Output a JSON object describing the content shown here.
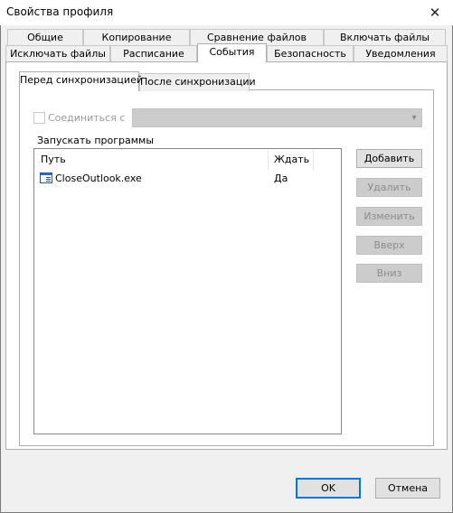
{
  "window": {
    "title": "Свойства профиля"
  },
  "tabs_row1": [
    "Общие",
    "Копирование",
    "Сравнение файлов",
    "Включать файлы"
  ],
  "tabs_row2": [
    "Исключать файлы",
    "Расписание",
    "События",
    "Безопасность",
    "Уведомления"
  ],
  "selected_tab": "События",
  "subtabs": [
    "Перед синхронизацией",
    "После синхронизации"
  ],
  "selected_subtab": "Перед синхронизацией",
  "connect": {
    "label": "Соединиться с",
    "checked": false,
    "value": ""
  },
  "programs": {
    "label": "Запускать программы",
    "columns": {
      "path": "Путь",
      "wait": "Ждать"
    },
    "rows": [
      {
        "path": "CloseOutlook.exe",
        "wait": "Да"
      }
    ]
  },
  "actions": {
    "add": "Добавить",
    "remove": "Удалить",
    "edit": "Изменить",
    "up": "Вверх",
    "down": "Вниз"
  },
  "footer": {
    "ok": "OK",
    "cancel": "Отмена"
  }
}
